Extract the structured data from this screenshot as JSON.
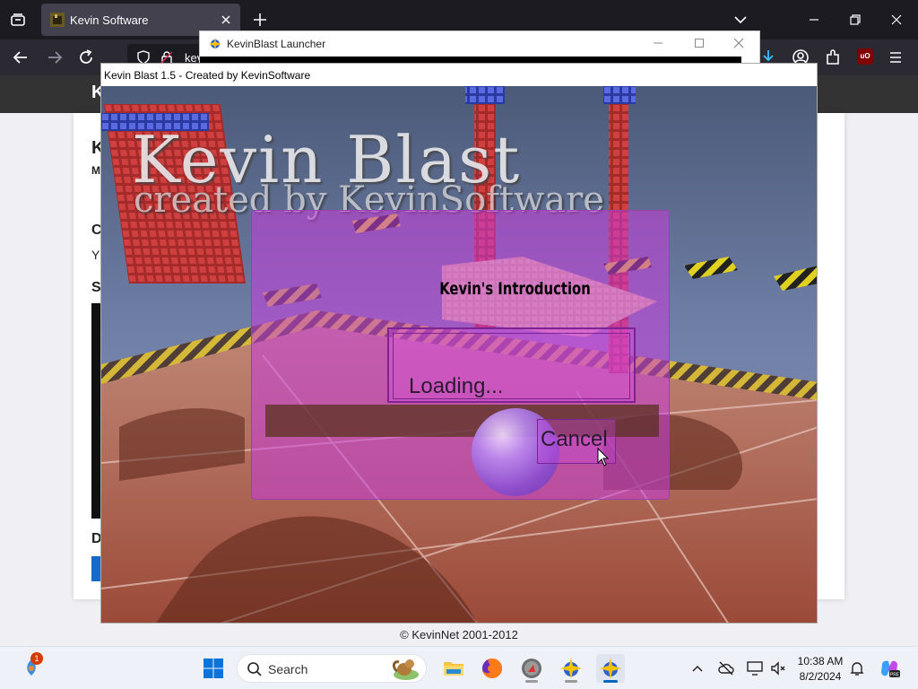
{
  "browser": {
    "tab_title": "Kevin Software",
    "url_visible": "kev"
  },
  "page": {
    "header_letter": "K",
    "frag_heading": "K",
    "frag_sub": "M",
    "frag_c": "C",
    "frag_y": "Y",
    "frag_s": "S",
    "frag_d": "D",
    "footer": "© KevinNet 2001-2012"
  },
  "launcher": {
    "title": "KevinBlast Launcher"
  },
  "game": {
    "window_title": "Kevin Blast 1.5 - Created by KevinSoftware",
    "logo_title": "Kevin Blast",
    "logo_subtitle": "created by KevinSoftware",
    "dialog_heading": "Kevin's Introduction",
    "status_text": "Loading...",
    "cancel_label": "Cancel"
  },
  "taskbar": {
    "notification_count": "1",
    "search_placeholder": "Search",
    "time": "10:38 AM",
    "date": "8/2/2024"
  },
  "colors": {
    "browser_dark": "#1c1b22",
    "dialog_purple": "#c83cdc",
    "accent_blue": "#0067c0"
  }
}
